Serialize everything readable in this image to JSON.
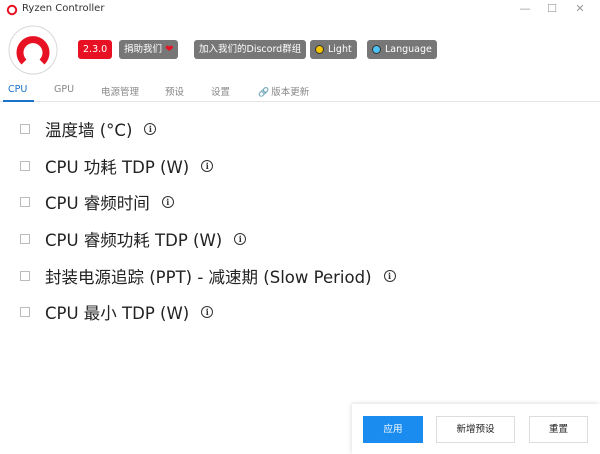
{
  "window": {
    "title": "Ryzen Controller",
    "minimize_glyph": "—",
    "maximize_glyph": "☐",
    "close_glyph": "✕"
  },
  "badges": {
    "version": "2.3.0",
    "donate": "捐助我们",
    "discord": "加入我们的Discord群组",
    "light": "Light",
    "language": "Language"
  },
  "tabs": [
    {
      "label": "CPU",
      "active": true
    },
    {
      "label": "GPU",
      "active": false
    },
    {
      "label": "电源管理",
      "active": false
    },
    {
      "label": "预设",
      "active": false
    },
    {
      "label": "设置",
      "active": false
    },
    {
      "label": "版本更新",
      "active": false,
      "icon": "link-icon"
    }
  ],
  "options": [
    {
      "label": "温度墙 (°C)",
      "checked": false
    },
    {
      "label": "CPU 功耗 TDP (W)",
      "checked": false
    },
    {
      "label": "CPU 睿频时间",
      "checked": false
    },
    {
      "label": "CPU 睿频功耗 TDP (W)",
      "checked": false
    },
    {
      "label": "封装电源追踪 (PPT) - 减速期 (Slow Period)",
      "checked": false
    },
    {
      "label": "CPU 最小 TDP (W)",
      "checked": false
    }
  ],
  "actions": {
    "apply": "应用",
    "new_preset": "新增预设",
    "reset": "重置"
  },
  "colors": {
    "accent": "#1a8cf0",
    "tab_active": "#1a73c8",
    "version_badge": "#e81123",
    "badge_gray": "#777777",
    "light_dot": "#f5c400",
    "language_dot": "#4fc3f7",
    "logo_red": "#e81123"
  }
}
